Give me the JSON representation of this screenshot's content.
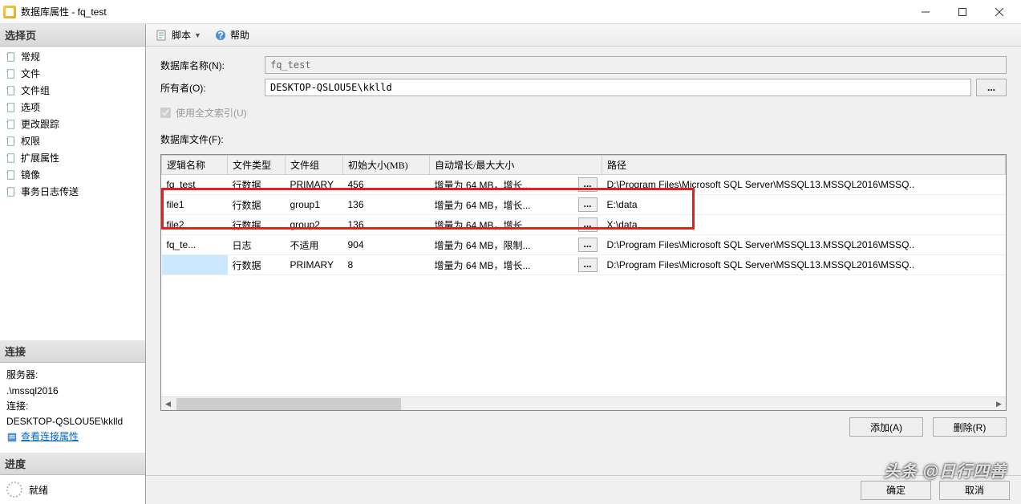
{
  "window": {
    "title": "数据库属性 - fq_test"
  },
  "sidebar": {
    "select_page_header": "选择页",
    "items": [
      {
        "label": "常规"
      },
      {
        "label": "文件"
      },
      {
        "label": "文件组"
      },
      {
        "label": "选项"
      },
      {
        "label": "更改跟踪"
      },
      {
        "label": "权限"
      },
      {
        "label": "扩展属性"
      },
      {
        "label": "镜像"
      },
      {
        "label": "事务日志传送"
      }
    ],
    "connection_header": "连接",
    "connection": {
      "server_label": "服务器:",
      "server_value": ".\\mssql2016",
      "conn_label": "连接:",
      "conn_value": "DESKTOP-QSLOU5E\\kklld",
      "view_props_link": "查看连接属性"
    },
    "progress_header": "进度",
    "progress_status": "就绪"
  },
  "toolbar": {
    "script_label": "脚本",
    "help_label": "帮助"
  },
  "form": {
    "dbname_label": "数据库名称(N):",
    "dbname_value": "fq_test",
    "owner_label": "所有者(O):",
    "owner_value": "DESKTOP-QSLOU5E\\kklld",
    "browse_label": "...",
    "fulltext_label": "使用全文索引(U)",
    "files_label": "数据库文件(F):"
  },
  "grid": {
    "headers": {
      "logical_name": "逻辑名称",
      "file_type": "文件类型",
      "filegroup": "文件组",
      "initial_size": "初始大小(MB)",
      "autogrowth": "自动增长/最大大小",
      "path": "路径"
    },
    "rows": [
      {
        "name": "fq_test",
        "type": "行数据",
        "group": "PRIMARY",
        "size": "456",
        "growth": "增量为 64 MB，增长...",
        "path": "D:\\Program Files\\Microsoft SQL Server\\MSSQL13.MSSQL2016\\MSSQ.."
      },
      {
        "name": "file1",
        "type": "行数据",
        "group": "group1",
        "size": "136",
        "growth": "增量为 64 MB，增长...",
        "path": "E:\\data"
      },
      {
        "name": "file2",
        "type": "行数据",
        "group": "group2",
        "size": "136",
        "growth": "增量为 64 MB，增长...",
        "path": "X:\\data"
      },
      {
        "name": "fq_te...",
        "type": "日志",
        "group": "不适用",
        "size": "904",
        "growth": "增量为 64 MB，限制...",
        "path": "D:\\Program Files\\Microsoft SQL Server\\MSSQL13.MSSQL2016\\MSSQ.."
      },
      {
        "name": "",
        "type": "行数据",
        "group": "PRIMARY",
        "size": "8",
        "growth": "增量为 64 MB，增长...",
        "path": "D:\\Program Files\\Microsoft SQL Server\\MSSQL13.MSSQL2016\\MSSQ.."
      }
    ],
    "ellipsis": "..."
  },
  "actions": {
    "add_label": "添加(A)",
    "remove_label": "删除(R)"
  },
  "footer": {
    "ok_label": "确定",
    "cancel_label": "取消"
  },
  "watermark": "头条 @日行四善"
}
